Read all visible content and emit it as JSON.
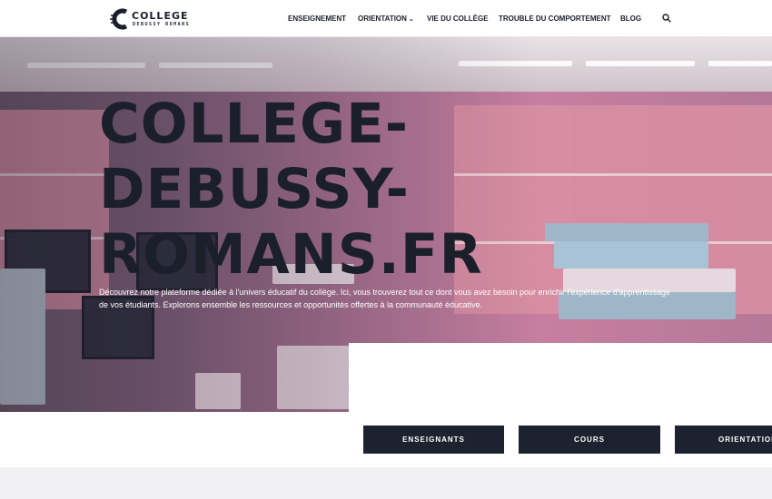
{
  "header": {
    "logo": {
      "title": "COLLEGE",
      "subtitle": "DEBUSSY ROMANS",
      "icon": "c-logo-icon"
    },
    "nav": [
      {
        "label": "ENSEIGNEMENT",
        "dropdown": false
      },
      {
        "label": "ORIENTATION",
        "dropdown": true
      },
      {
        "label": "VIE DU COLLÈGE",
        "dropdown": false
      },
      {
        "label": "TROUBLE DU COMPORTEMENT",
        "dropdown": false
      },
      {
        "label": "BLOG",
        "dropdown": false
      }
    ],
    "search_icon": "search-icon",
    "chevron": "⌄"
  },
  "hero": {
    "title_lines": [
      "COLLEGE-",
      "DEBUSSY-",
      "ROMANS.FR"
    ],
    "description": "Découvrez notre plateforme dédiée à l'univers éducatif du collège. Ici, vous trouverez tout ce dont vous avez besoin pour enrichir l'expérience d'apprentissage de vos étudiants. Explorons ensemble les ressources et opportunités offertes à la communauté éducative."
  },
  "buttons": [
    {
      "label": "ENSEIGNANTS"
    },
    {
      "label": "COURS"
    },
    {
      "label": "ORIENTATION"
    }
  ],
  "colors": {
    "dark": "#1c2230",
    "text": "#1b1f2a",
    "hero_pink": "#c77fa0"
  }
}
